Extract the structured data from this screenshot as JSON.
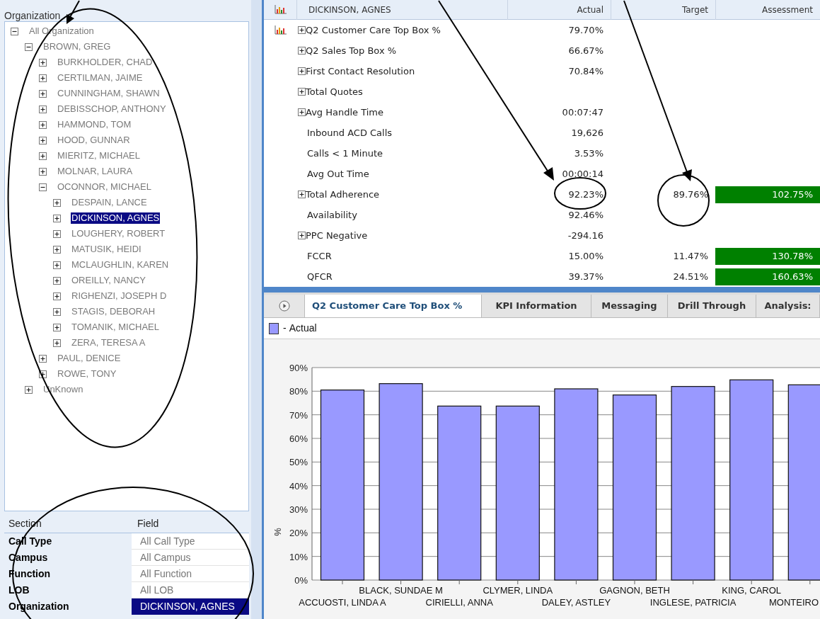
{
  "organization": {
    "title": "Organization",
    "tree": [
      {
        "label": "All Organization",
        "expanded": true,
        "selected": false,
        "children": [
          {
            "label": "BROWN, GREG",
            "expanded": true,
            "selected": false,
            "children": [
              {
                "label": "BURKHOLDER, CHAD",
                "expanded": false,
                "selected": false
              },
              {
                "label": "CERTILMAN, JAIME",
                "expanded": false,
                "selected": false
              },
              {
                "label": "CUNNINGHAM, SHAWN",
                "expanded": false,
                "selected": false
              },
              {
                "label": "DEBISSCHOP, ANTHONY",
                "expanded": false,
                "selected": false
              },
              {
                "label": "HAMMOND, TOM",
                "expanded": false,
                "selected": false
              },
              {
                "label": "HOOD, GUNNAR",
                "expanded": false,
                "selected": false
              },
              {
                "label": "MIERITZ, MICHAEL",
                "expanded": false,
                "selected": false
              },
              {
                "label": "MOLNAR, LAURA",
                "expanded": false,
                "selected": false
              },
              {
                "label": "OCONNOR, MICHAEL",
                "expanded": true,
                "selected": false,
                "children": [
                  {
                    "label": "DESPAIN, LANCE",
                    "expanded": false,
                    "selected": false
                  },
                  {
                    "label": "DICKINSON, AGNES",
                    "expanded": false,
                    "selected": true
                  },
                  {
                    "label": "LOUGHERY, ROBERT",
                    "expanded": false,
                    "selected": false
                  },
                  {
                    "label": "MATUSIK, HEIDI",
                    "expanded": false,
                    "selected": false
                  },
                  {
                    "label": "MCLAUGHLIN, KAREN",
                    "expanded": false,
                    "selected": false
                  },
                  {
                    "label": "OREILLY, NANCY",
                    "expanded": false,
                    "selected": false
                  },
                  {
                    "label": "RIGHENZI, JOSEPH D",
                    "expanded": false,
                    "selected": false
                  },
                  {
                    "label": "STAGIS, DEBORAH",
                    "expanded": false,
                    "selected": false
                  },
                  {
                    "label": "TOMANIK, MICHAEL",
                    "expanded": false,
                    "selected": false
                  },
                  {
                    "label": "ZERA, TERESA A",
                    "expanded": false,
                    "selected": false
                  }
                ]
              },
              {
                "label": "PAUL, DENICE",
                "expanded": false,
                "selected": false
              },
              {
                "label": "ROWE, TONY",
                "expanded": false,
                "selected": false
              }
            ]
          },
          {
            "label": "UnKnown",
            "expanded": false,
            "selected": false
          }
        ]
      }
    ]
  },
  "filters": {
    "columns": [
      "Section",
      "Field"
    ],
    "rows": [
      {
        "section": "Call Type",
        "field": "All Call Type",
        "selected": false
      },
      {
        "section": "Campus",
        "field": "All Campus",
        "selected": false
      },
      {
        "section": "Function",
        "field": "All Function",
        "selected": false
      },
      {
        "section": "LOB",
        "field": "All LOB",
        "selected": false
      },
      {
        "section": "Organization",
        "field": "DICKINSON, AGNES",
        "selected": true
      }
    ]
  },
  "kpi_table": {
    "columns": [
      "DICKINSON, AGNES",
      "Actual",
      "Target",
      "Assessment"
    ],
    "rows": [
      {
        "name": "Q2 Customer Care Top Box %",
        "expandable": true,
        "charted": true,
        "actual": "79.70%"
      },
      {
        "name": "Q2 Sales Top Box %",
        "expandable": true,
        "charted": false,
        "actual": "66.67%"
      },
      {
        "name": "First Contact Resolution",
        "expandable": true,
        "charted": false,
        "actual": "70.84%"
      },
      {
        "name": "Total Quotes",
        "expandable": true,
        "charted": false
      },
      {
        "name": "Avg Handle Time",
        "expandable": true,
        "charted": false,
        "actual": "00:07:47"
      },
      {
        "name": "Inbound ACD Calls",
        "expandable": false,
        "charted": false,
        "actual": "19,626"
      },
      {
        "name": "Calls < 1 Minute",
        "expandable": false,
        "charted": false,
        "actual": "3.53%"
      },
      {
        "name": "Avg Out Time",
        "expandable": false,
        "charted": false,
        "actual": "00:00:14"
      },
      {
        "name": "Total Adherence",
        "expandable": true,
        "charted": false,
        "actual": "92.23%",
        "target": "89.76%",
        "assessment": "102.75%"
      },
      {
        "name": "Availability",
        "expandable": false,
        "charted": false,
        "actual": "92.46%"
      },
      {
        "name": "PPC Negative",
        "expandable": true,
        "charted": false,
        "actual": "-294.16"
      },
      {
        "name": "FCCR",
        "expandable": false,
        "charted": false,
        "actual": "15.00%",
        "target": "11.47%",
        "assessment": "130.78%"
      },
      {
        "name": "QFCR",
        "expandable": false,
        "charted": false,
        "actual": "39.37%",
        "target": "24.51%",
        "assessment": "160.63%"
      }
    ]
  },
  "detail_tabs": [
    {
      "label": "Q2 Customer Care Top Box %",
      "selected": true
    },
    {
      "label": "KPI Information",
      "selected": false
    },
    {
      "label": "Messaging",
      "selected": false
    },
    {
      "label": "Drill Through",
      "selected": false
    },
    {
      "label": "Analysis:",
      "selected": false
    }
  ],
  "legend": {
    "prefix": "-"
  },
  "chart_data": {
    "type": "bar",
    "ylabel": "%",
    "grid": true,
    "categories": [
      "ACCUOSTI, LINDA A",
      "BLACK, SUNDAE M",
      "CIRIELLI, ANNA",
      "CLYMER, LINDA",
      "DALEY, ASTLEY",
      "GAGNON, BETH",
      "INGLESE, PATRICIA",
      "KING, CAROL",
      "MONTEIRO"
    ],
    "series": [
      {
        "name": "Actual",
        "color": "#9999ff",
        "values": [
          80.5,
          83.2,
          73.7,
          73.7,
          81.0,
          78.4,
          82.0,
          84.8,
          82.7
        ]
      }
    ],
    "ylim": [
      0,
      90
    ],
    "yticks": [
      {
        "value": 0,
        "label": "0%"
      },
      {
        "value": 10,
        "label": "10%"
      },
      {
        "value": 20,
        "label": "20%"
      },
      {
        "value": 30,
        "label": "30%"
      },
      {
        "value": 40,
        "label": "40%"
      },
      {
        "value": 50,
        "label": "50%"
      },
      {
        "value": 60,
        "label": "60%"
      },
      {
        "value": 70,
        "label": "70%"
      },
      {
        "value": 80,
        "label": "80%"
      },
      {
        "value": 90,
        "label": "90%"
      }
    ]
  }
}
